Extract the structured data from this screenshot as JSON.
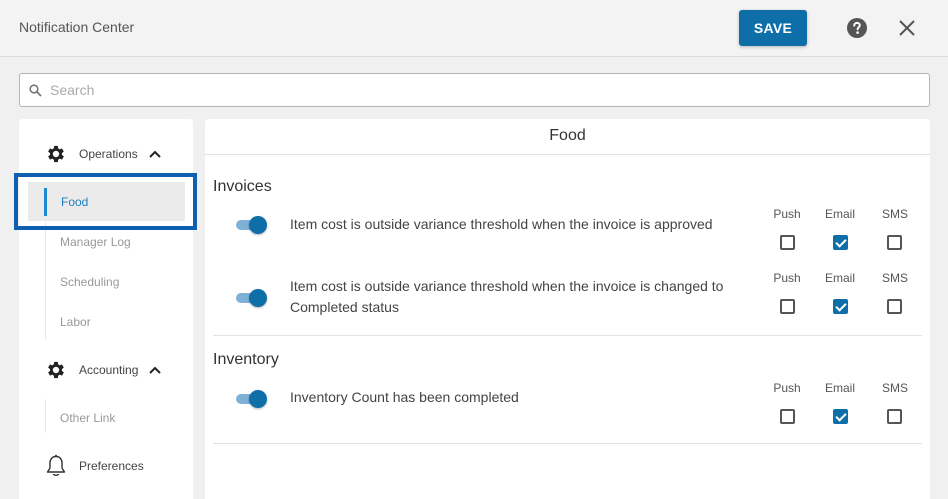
{
  "header": {
    "title": "Notification Center",
    "save_label": "SAVE",
    "help_icon": "help-circle-icon",
    "close_icon": "close-icon"
  },
  "search": {
    "placeholder": "Search",
    "value": ""
  },
  "sidebar": {
    "groups": [
      {
        "label": "Operations",
        "icon": "gear-icon",
        "expanded": true,
        "items": [
          "Food",
          "Manager Log",
          "Scheduling",
          "Labor"
        ],
        "selected": "Food"
      },
      {
        "label": "Accounting",
        "icon": "gear-icon",
        "expanded": true,
        "items": [
          "Other Link"
        ]
      }
    ],
    "preferences": {
      "label": "Preferences",
      "icon": "bell-icon"
    }
  },
  "main": {
    "title": "Food",
    "channels": [
      "Push",
      "Email",
      "SMS"
    ],
    "sections": [
      {
        "title": "Invoices",
        "rules": [
          {
            "text": "Item cost is outside variance threshold when the invoice is approved",
            "enabled": true,
            "push": false,
            "email": true,
            "sms": false
          },
          {
            "text": "Item cost is outside variance threshold when the invoice is changed to Completed status",
            "enabled": true,
            "push": false,
            "email": true,
            "sms": false
          }
        ]
      },
      {
        "title": "Inventory",
        "rules": [
          {
            "text": "Inventory Count has been completed",
            "enabled": true,
            "push": false,
            "email": true,
            "sms": false
          }
        ]
      }
    ]
  },
  "colors": {
    "accent": "#0e6fa8",
    "selected_accent": "#1e88d0",
    "highlight_border": "#0d5fb0"
  }
}
